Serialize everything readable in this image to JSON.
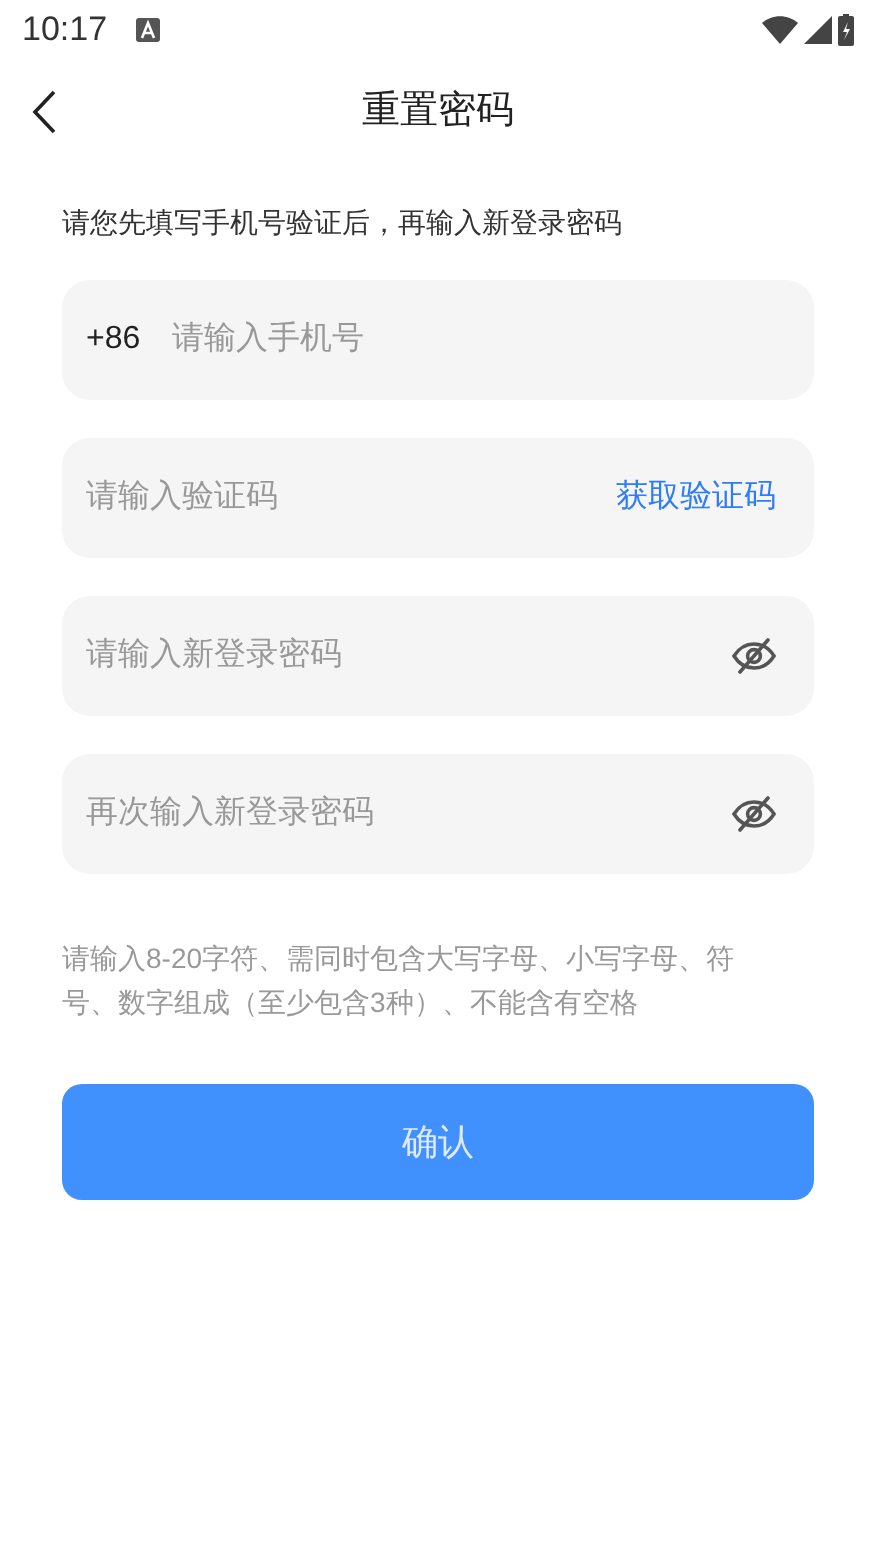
{
  "status_bar": {
    "time": "10:17"
  },
  "header": {
    "title": "重置密码"
  },
  "intro": "请您先填写手机号验证后，再输入新登录密码",
  "fields": [
    {
      "kind": "phone",
      "prefix": "+86",
      "placeholder": "请输入手机号"
    },
    {
      "kind": "code",
      "placeholder": "请输入验证码",
      "action": "获取验证码"
    },
    {
      "kind": "password",
      "placeholder": "请输入新登录密码",
      "masked": true
    },
    {
      "kind": "password",
      "placeholder": "再次输入新登录密码",
      "masked": true
    }
  ],
  "hint": "请输入8-20字符、需同时包含大写字母、小写字母、符号、数字组成（至少包含3种）、不能含有空格",
  "submit": {
    "label": "确认"
  }
}
